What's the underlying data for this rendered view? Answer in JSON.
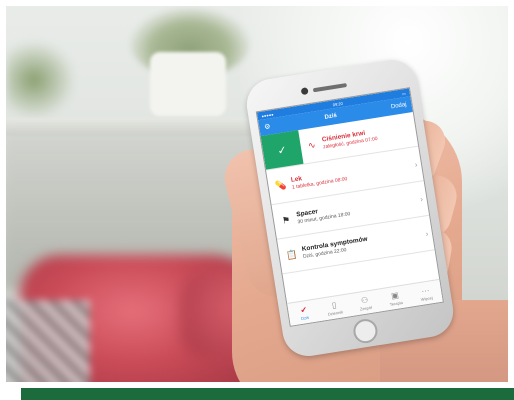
{
  "colors": {
    "accent_blue": "#2b8be8",
    "alert_red": "#d9303a",
    "done_green": "#1fa46a",
    "banner_green": "#1b6b3d"
  },
  "app": {
    "status_time": "09:20",
    "nav": {
      "left_icon": "settings-icon",
      "title": "Dziś",
      "right_label": "Dodaj"
    },
    "items": [
      {
        "title": "Ciśnienie krwi",
        "subtitle": "zaległość, godzina 07:00",
        "icon": "heart-pulse-icon",
        "state": "done",
        "check_icon": "checkmark-icon"
      },
      {
        "title": "Lek",
        "subtitle": "1 tabletka, godzina 08:00",
        "icon": "pill-icon",
        "state": "alert"
      },
      {
        "title": "Spacer",
        "subtitle": "30 minut, godzina 18:00",
        "icon": "flag-icon",
        "state": "normal"
      },
      {
        "title": "Kontrola symptomów",
        "subtitle": "Dziś, godzina 22:00",
        "icon": "clipboard-icon",
        "state": "normal"
      }
    ],
    "tabs": [
      {
        "label": "Dziś",
        "icon": "checklist-icon",
        "active": true
      },
      {
        "label": "Dziennik",
        "icon": "journal-icon",
        "active": false
      },
      {
        "label": "Zespół",
        "icon": "team-icon",
        "active": false
      },
      {
        "label": "Terapia",
        "icon": "therapy-icon",
        "active": false
      },
      {
        "label": "Więcej",
        "icon": "more-icon",
        "active": false
      }
    ]
  }
}
